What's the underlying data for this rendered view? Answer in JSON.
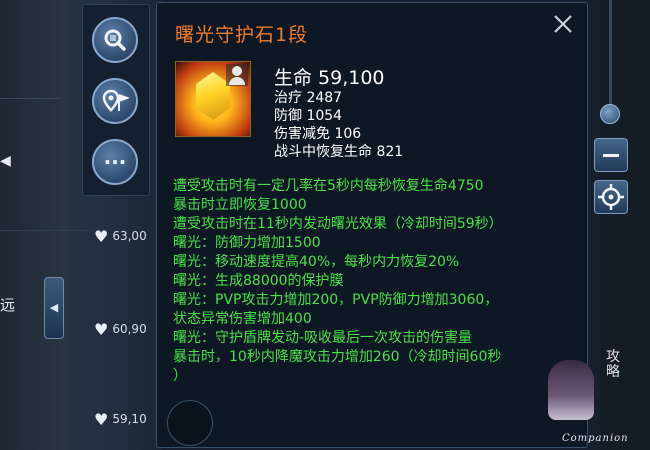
{
  "tooltip": {
    "title": "曙光守护石1段",
    "stats": {
      "main": "生命 59,100",
      "lines": [
        "治疗 2487",
        "防御 1054",
        "伤害减免 106",
        "战斗中恢复生命 821"
      ]
    },
    "effects": [
      "遭受攻击时有一定几率在5秒内每秒恢复生命4750",
      "暴击时立即恢复1000",
      "遭受攻击时在11秒内发动曙光效果（冷却时间59秒）",
      "曙光：防御力增加1500",
      "曙光：移动速度提高40%，每秒内力恢复20%",
      "曙光：生成88000的保护膜",
      "曙光：PVP攻击力增加200，PVP防御力增加3060，",
      "状态异常伤害增加400",
      "曙光：守护盾牌发动-吸收最后一次攻击的伤害量",
      "暴击时，10秒内降魔攻击力增加260（冷却时间60秒",
      "）"
    ],
    "close_icon": "close-icon"
  },
  "toolbar": {
    "buttons": [
      {
        "icon": "search-icon"
      },
      {
        "icon": "map-pin-flag-icon"
      },
      {
        "icon": "more-icon",
        "label": "···"
      }
    ]
  },
  "left_panel": {
    "arrow": "◀",
    "partial_text": "远",
    "scroll_button": "◀"
  },
  "list": {
    "items": [
      {
        "value": "63,00"
      },
      {
        "value": "60,90"
      },
      {
        "value": "59,10"
      }
    ]
  },
  "watermark": {
    "vertical_text": "攻略",
    "label": "Companion"
  },
  "colors": {
    "title": "#f07c2a",
    "effects": "#48e048",
    "panel_bg": "#0e1824"
  }
}
